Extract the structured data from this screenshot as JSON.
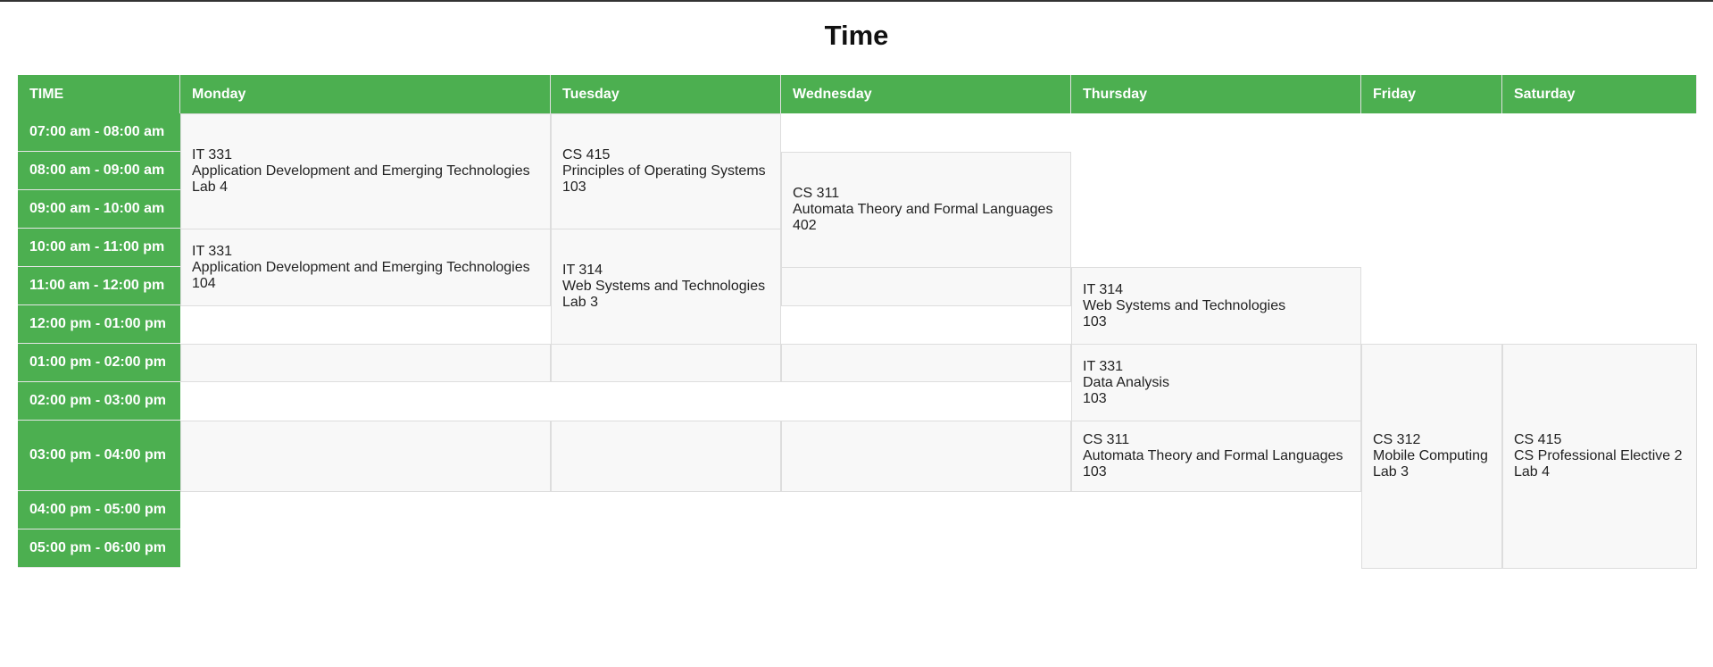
{
  "page": {
    "title": "Time"
  },
  "header": {
    "time": "TIME",
    "days": [
      "Monday",
      "Tuesday",
      "Wednesday",
      "Thursday",
      "Friday",
      "Saturday"
    ]
  },
  "times": [
    "07:00 am - 08:00 am",
    "08:00 am - 09:00 am",
    "09:00 am - 10:00 am",
    "10:00 am - 11:00 pm",
    "11:00 am - 12:00 pm",
    "12:00 pm - 01:00 pm",
    "01:00 pm - 02:00 pm",
    "02:00 pm - 03:00 pm",
    "03:00 pm - 04:00 pm",
    "04:00 pm - 05:00 pm",
    "05:00 pm - 06:00 pm"
  ],
  "classes": {
    "mon1": {
      "code": "IT 331",
      "title": "Application Development and Emerging Technologies",
      "room": "Lab 4"
    },
    "mon2": {
      "code": "IT 331",
      "title": "Application Development and Emerging Technologies",
      "room": "104"
    },
    "tue1": {
      "code": "CS 415",
      "title": "Principles of Operating Systems",
      "room": "103"
    },
    "tue2": {
      "code": "IT 314",
      "title": "Web Systems and Technologies",
      "room": "Lab 3"
    },
    "wed1": {
      "code": "CS 311",
      "title": "Automata Theory and Formal Languages",
      "room": "402"
    },
    "thu1": {
      "code": "IT 314",
      "title": "Web Systems and Technologies",
      "room": "103"
    },
    "thu2": {
      "code": "IT 331",
      "title": "Data Analysis",
      "room": "103"
    },
    "thu3": {
      "code": "CS 311",
      "title": "Automata Theory and Formal Languages",
      "room": "103"
    },
    "fri1": {
      "code": "CS 312",
      "title": "Mobile Computing",
      "room": "Lab 3"
    },
    "sat1": {
      "code": "CS 415",
      "title": "CS Professional Elective 2",
      "room": "Lab 4"
    }
  }
}
